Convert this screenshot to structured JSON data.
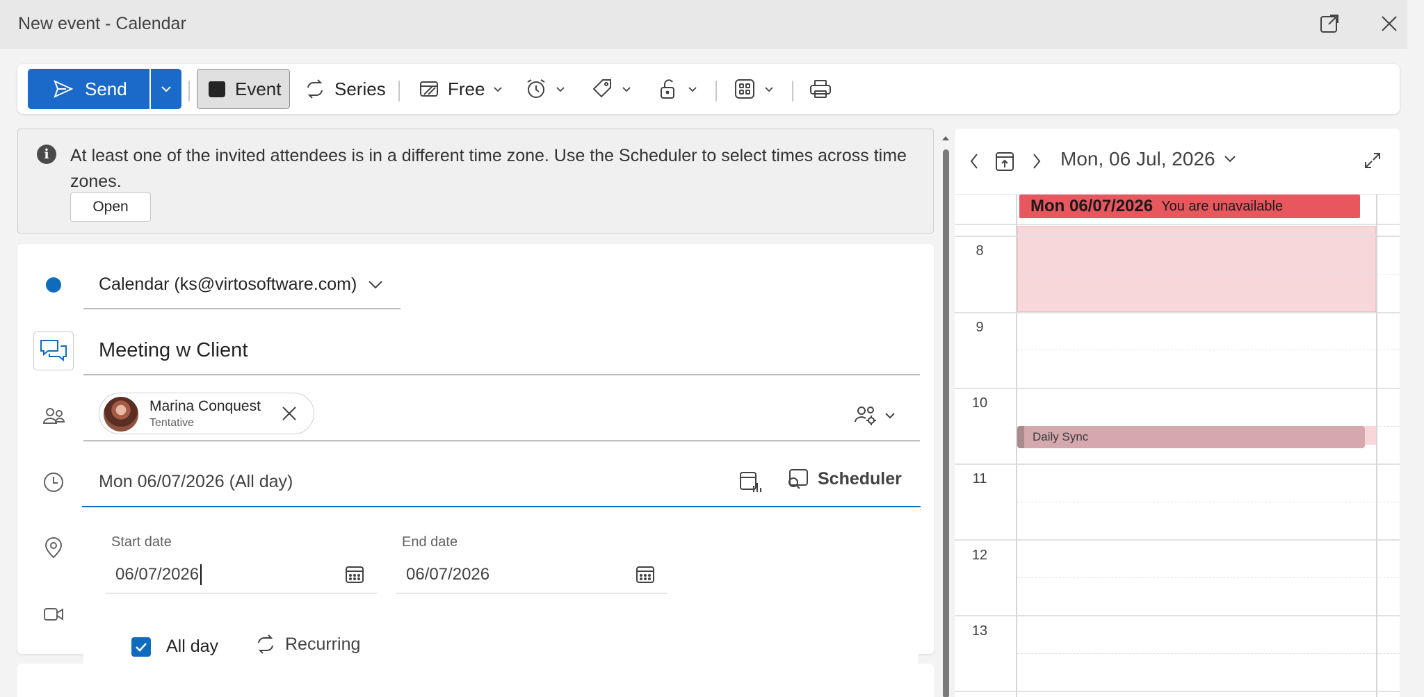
{
  "window": {
    "title": "New event - Calendar"
  },
  "toolbar": {
    "send_label": "Send",
    "event_label": "Event",
    "series_label": "Series",
    "show_as_label": "Free"
  },
  "banner": {
    "message": "At least one of the invited attendees is in a different time zone. Use the Scheduler to select times across time zones.",
    "open_label": "Open"
  },
  "form": {
    "calendar": "Calendar (ks@virtosoftware.com)",
    "title": "Meeting w Client",
    "attendees": [
      {
        "name": "Marina Conquest",
        "status": "Tentative"
      }
    ],
    "date_summary": "Mon 06/07/2026 (All day)",
    "scheduler_label": "Scheduler",
    "start_date_label": "Start date",
    "start_date": "06/07/2026",
    "end_date_label": "End date",
    "end_date": "06/07/2026",
    "all_day_label": "All day",
    "all_day_checked": true,
    "recurring_label": "Recurring"
  },
  "calendar_pane": {
    "date": "Mon, 06 Jul, 2026",
    "unavailable": {
      "date": "Mon 06/07/2026",
      "text": "You are unavailable"
    },
    "hours": [
      "8",
      "9",
      "10",
      "11",
      "12",
      "13"
    ],
    "events": [
      {
        "title": "Daily Sync"
      }
    ]
  },
  "colors": {
    "accent": "#0f6cbd",
    "send": "#1b6ac9",
    "unavailable": "#e9575e",
    "unavailable_band": "#f8d7da",
    "event": "#d4a8ad"
  }
}
